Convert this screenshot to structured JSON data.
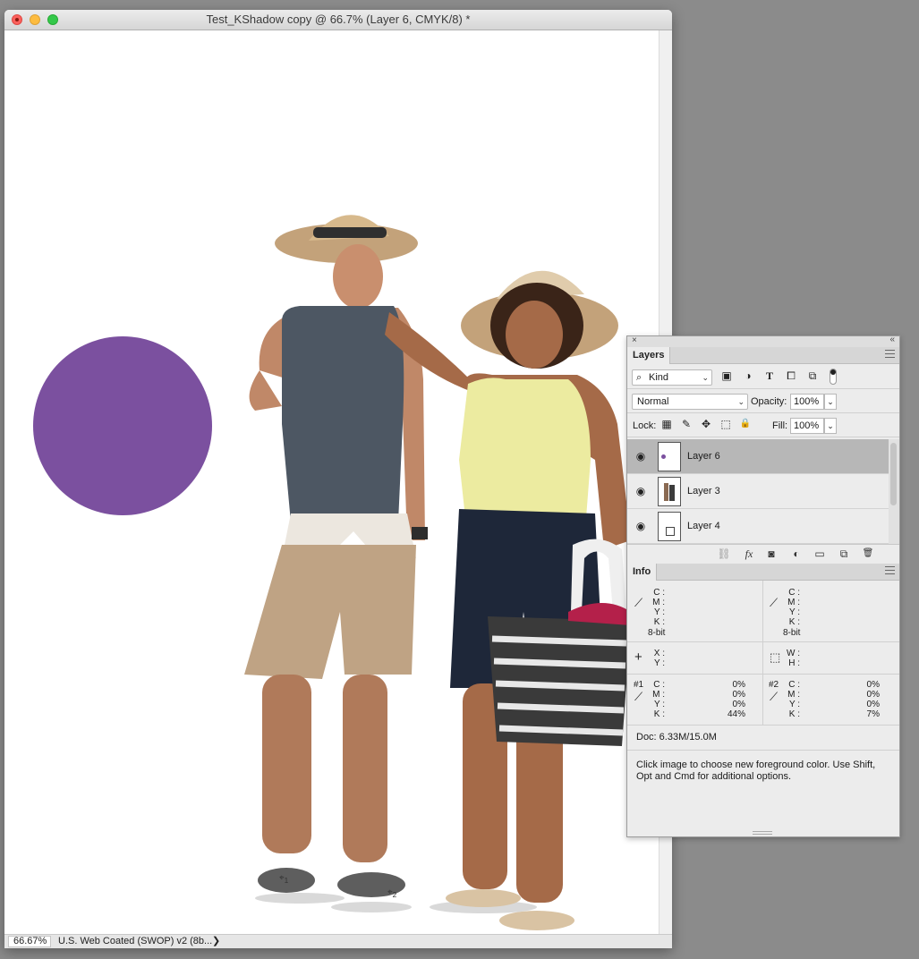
{
  "document": {
    "title": "Test_KShadow copy @ 66.7% (Layer 6, CMYK/8) *",
    "zoom": "66.67%",
    "color_profile": "U.S. Web Coated (SWOP) v2 (8b...",
    "profile_arrow": "❯",
    "markers": [
      {
        "symbol": "⌖",
        "index": "1"
      },
      {
        "symbol": "⌖",
        "index": "2"
      }
    ],
    "circle_color": "#7b509f"
  },
  "panel": {
    "close_glyph": "×",
    "collapse_glyph": "«"
  },
  "layers": {
    "tab": "Layers",
    "kind_label": "Kind",
    "kind_icon": "⌕",
    "kind_chevron": "⌄",
    "filter_icons": [
      "image-filter-icon",
      "adjustment-filter-icon",
      "type-filter-icon",
      "shape-filter-icon",
      "smart-object-filter-icon"
    ],
    "filter_glyphs": [
      "▣",
      "◑",
      "T",
      "⧠",
      "⧉"
    ],
    "blend_mode": "Normal",
    "opacity_label": "Opacity:",
    "opacity_value": "100%",
    "lock_label": "Lock:",
    "lock_glyphs": [
      "▦",
      "✎",
      "✥",
      "⬚",
      "🔒"
    ],
    "fill_label": "Fill:",
    "fill_value": "100%",
    "eye_glyph": "◉",
    "items": [
      {
        "name": "Layer 6",
        "selected": true
      },
      {
        "name": "Layer 3",
        "selected": false
      },
      {
        "name": "Layer 4",
        "selected": false
      }
    ],
    "footer_glyphs": [
      "⛓",
      "fx",
      "◙",
      "◐",
      "▭",
      "⧉",
      "🗑"
    ]
  },
  "info": {
    "tab": "Info",
    "eyedropper_glyph": "⟋",
    "crosshair_glyph": "+",
    "select_glyph": "⬚",
    "cmyk_labels": [
      "C :",
      "M :",
      "Y :",
      "K :"
    ],
    "bit_depth": "8-bit",
    "xy_labels": [
      "X :",
      "Y :"
    ],
    "wh_labels": [
      "W :",
      "H :"
    ],
    "sampler1": {
      "id": "#1",
      "values": [
        "0%",
        "0%",
        "0%",
        "44%"
      ]
    },
    "sampler2": {
      "id": "#2",
      "values": [
        "0%",
        "0%",
        "0%",
        "7%"
      ]
    },
    "doc_size": "Doc: 6.33M/15.0M",
    "help_text": "Click image to choose new foreground color.  Use Shift, Opt and Cmd for additional options."
  }
}
